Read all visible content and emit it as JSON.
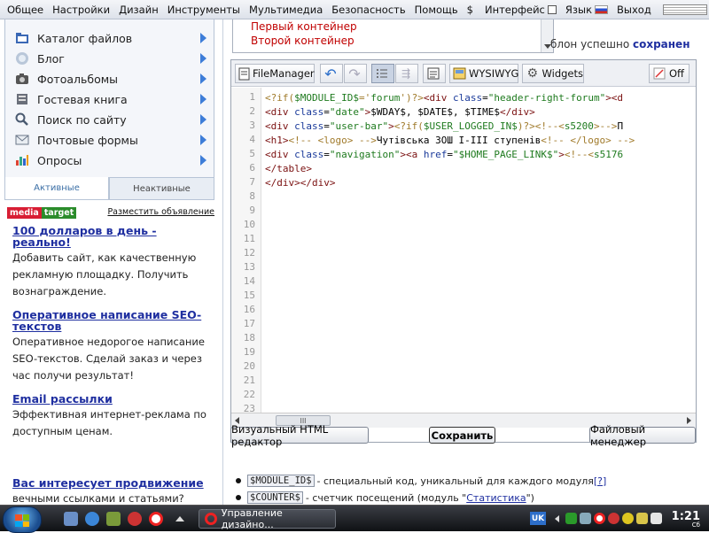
{
  "menu": {
    "items": [
      "Общее",
      "Настройки",
      "Дизайн",
      "Инструменты",
      "Мультимедиа",
      "Безопасность",
      "Помощь",
      "$"
    ],
    "interface_label": "Интерфейс",
    "language_label": "Язык",
    "logout_label": "Выход"
  },
  "sidebar": {
    "items": [
      {
        "label": "Каталог файлов",
        "icon": "folder-icon"
      },
      {
        "label": "Блог",
        "icon": "blog-icon"
      },
      {
        "label": "Фотоальбомы",
        "icon": "camera-icon"
      },
      {
        "label": "Гостевая книга",
        "icon": "book-icon"
      },
      {
        "label": "Поиск по сайту",
        "icon": "search-icon"
      },
      {
        "label": "Почтовые формы",
        "icon": "mail-icon"
      },
      {
        "label": "Опросы",
        "icon": "chart-icon"
      }
    ],
    "tab_active": "Активные",
    "tab_inactive": "Неактивные"
  },
  "ads": {
    "logo_a": "media",
    "logo_b": "target",
    "place_ad": "Разместить объявление",
    "items": [
      {
        "title": "100 долларов в день - реально!",
        "desc": "Добавить сайт, как качественную рекламную площадку. Получить вознаграждение."
      },
      {
        "title": "Оперативное написание SEO-текстов",
        "desc": "Оперативное недорогое написание SEO-текстов. Сделай заказ и через час получи результат!"
      },
      {
        "title": "Email рассылки",
        "desc": "Эффективная интернет-реклама по доступным ценам."
      },
      {
        "title": "Вас интересует продвижение",
        "desc": "вечными ссылками и статьями?"
      }
    ]
  },
  "container_select": {
    "options": [
      "Первый контейнер",
      "Второй контейнер"
    ]
  },
  "status": {
    "prefix": "блон успешно ",
    "bold": "сохранен"
  },
  "toolbar": {
    "filemanager": "FileManager",
    "wysiwyg": "WYSIWYG",
    "widgets": "Widgets",
    "off": "Off"
  },
  "editor": {
    "line_count": 23,
    "scroll_thumb": "III"
  },
  "buttons": {
    "visual_editor": "Визуальный HTML редактор",
    "save": "Сохранить",
    "file_manager": "Файловый менеджер"
  },
  "help": [
    {
      "code": "$MODULE_ID$",
      "text": " - специальный код, уникальный для каждого модуля ",
      "link": "[?]",
      "tail": ""
    },
    {
      "code": "$COUNTER$",
      "text": " - счетчик посещений (модуль \"",
      "link": "Статистика",
      "tail": "\")"
    }
  ],
  "taskbar": {
    "task_label": "Управление дизайно...",
    "lang": "UK",
    "time": "1:21",
    "day": "Сб"
  }
}
